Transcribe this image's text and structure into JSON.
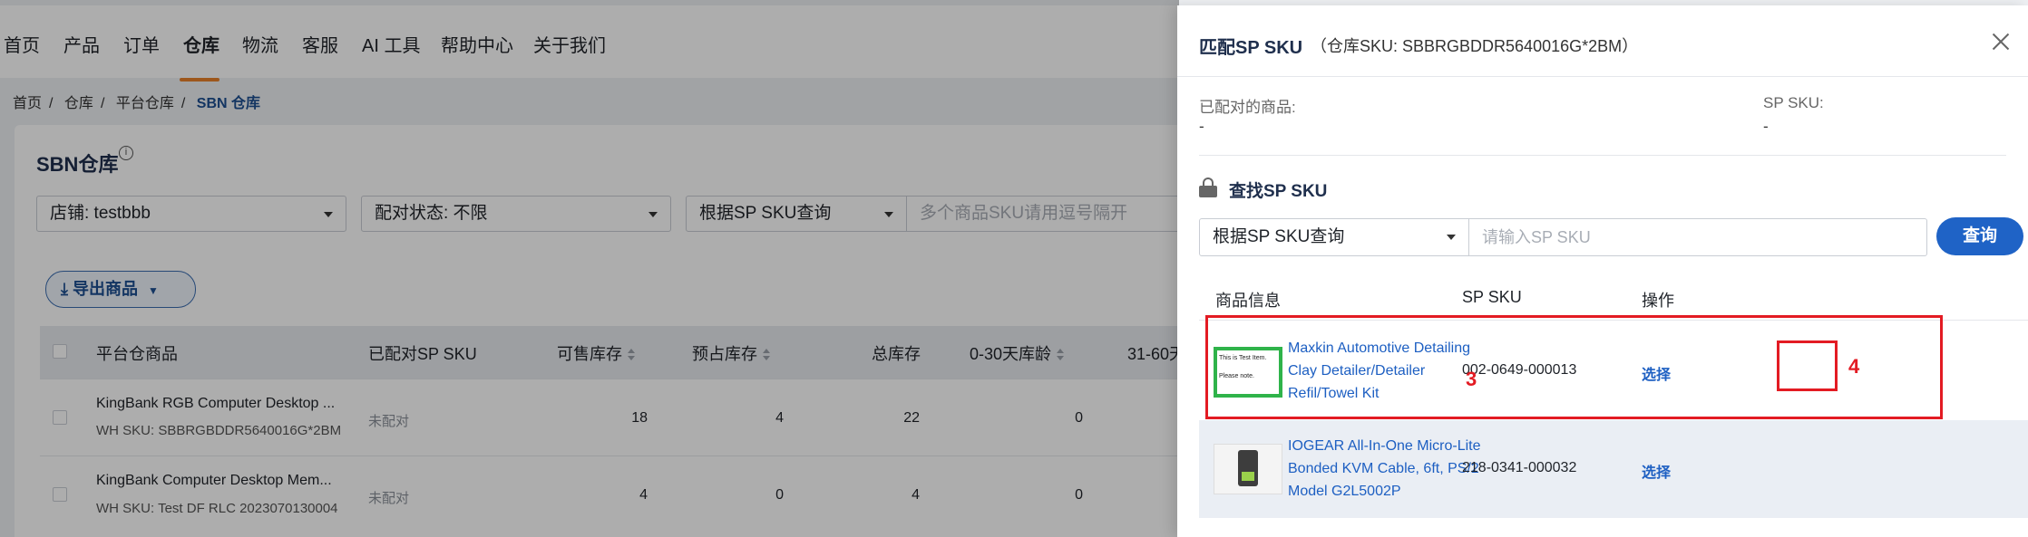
{
  "nav": {
    "items": [
      "首页",
      "产品",
      "订单",
      "仓库",
      "物流",
      "客服",
      "AI 工具",
      "帮助中心",
      "关于我们"
    ]
  },
  "breadcrumb": [
    "首页",
    "仓库",
    "平台仓库",
    "SBN 仓库"
  ],
  "page": {
    "title": "SBN仓库",
    "info_icon": "i"
  },
  "filters": {
    "shop": "店铺: testbbb",
    "match_status": "配对状态: 不限",
    "query_type": "根据SP SKU查询",
    "query_placeholder": "多个商品SKU请用逗号隔开"
  },
  "export_label": "导出商品",
  "table": {
    "headers": [
      "平台仓商品",
      "已配对SP SKU",
      "可售库存",
      "预占库存",
      "总库存",
      "0-30天库龄",
      "31-60天"
    ],
    "rows": [
      {
        "name": "KingBank RGB Computer Desktop ...",
        "wh_sku": "WH SKU: SBBRGBDDR5640016G*2BM",
        "matched": "未配对",
        "sellable": "18",
        "reserved": "4",
        "total": "22",
        "age": "0"
      },
      {
        "name": "KingBank Computer Desktop Mem...",
        "wh_sku": "WH SKU: Test DF RLC 2023070130004",
        "matched": "未配对",
        "sellable": "4",
        "reserved": "0",
        "total": "4",
        "age": "0"
      }
    ]
  },
  "drawer": {
    "title": "匹配SP SKU",
    "subtitle": "（仓库SKU: SBBRGBDDR5640016G*2BM）",
    "matched_label": "已配对的商品:",
    "matched_value": "-",
    "sp_sku_label": "SP SKU:",
    "sp_sku_value": "-",
    "find_title": "查找SP SKU",
    "search_type": "根据SP SKU查询",
    "search_placeholder": "请输入SP SKU",
    "search_button": "查询",
    "headers": [
      "商品信息",
      "SP SKU",
      "操作"
    ],
    "results": [
      {
        "name": "Maxkin Automotive Detailing Clay Detailer/Detailer Refil/Towel Kit",
        "sku": "002-0649-000013",
        "action": "选择",
        "thumb_text_1": "This is Test Item.",
        "thumb_text_2": "Please note."
      },
      {
        "name": "IOGEAR All-In-One Micro-Lite Bonded KVM Cable, 6ft, PS/2 Model G2L5002P",
        "sku": "218-0341-000032",
        "action": "选择"
      }
    ],
    "annotations": {
      "label_3": "3",
      "label_4": "4"
    }
  },
  "colors": {
    "accent": "#1f63c6",
    "highlight": "#e31b23",
    "nav_underline": "#e8812a"
  }
}
